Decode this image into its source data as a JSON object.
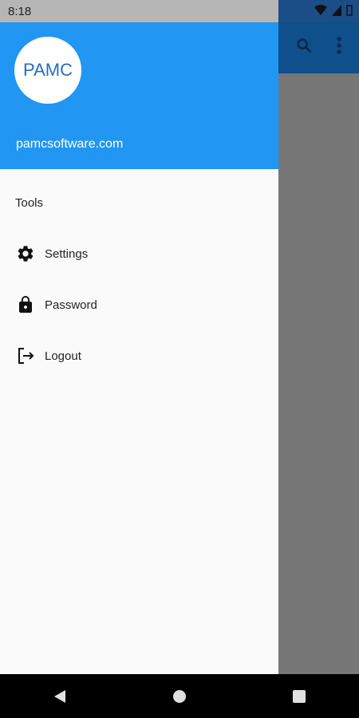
{
  "status_bar": {
    "time": "8:18"
  },
  "drawer": {
    "header": {
      "avatar_text": "PAMC",
      "site": "pamcsoftware.com"
    },
    "section_title": "Tools",
    "items": [
      {
        "label": "Settings",
        "icon": "gear-icon"
      },
      {
        "label": "Password",
        "icon": "lock-icon"
      },
      {
        "label": "Logout",
        "icon": "logout-icon"
      }
    ]
  },
  "colors": {
    "header": "#2196f3",
    "app_bar": "#0e4f8c",
    "scrim": "#777777"
  }
}
